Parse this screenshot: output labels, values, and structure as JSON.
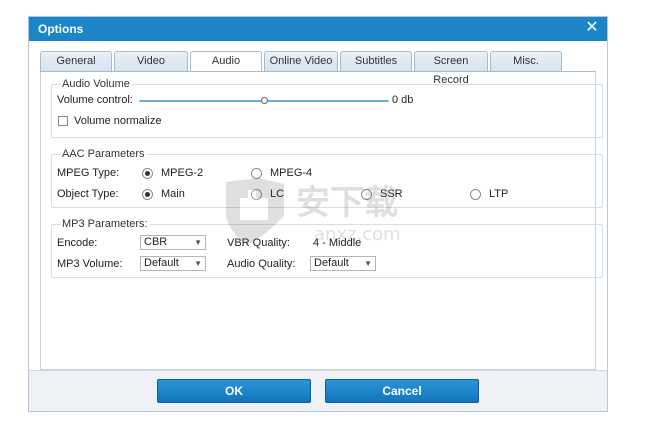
{
  "window": {
    "title": "Options",
    "close_glyph": "✕"
  },
  "tabs": [
    {
      "label": "General"
    },
    {
      "label": "Video"
    },
    {
      "label": "Audio"
    },
    {
      "label": "Online Video"
    },
    {
      "label": "Subtitles"
    },
    {
      "label": "Screen Record"
    },
    {
      "label": "Misc."
    }
  ],
  "active_tab": "Audio",
  "audio_volume": {
    "title": "Audio Volume",
    "volume_label": "Volume control:",
    "volume_value": "0 db",
    "volume_fraction": 0.5,
    "normalize_label": "Volume normalize",
    "normalize_checked": false
  },
  "aac": {
    "title": "AAC Parameters",
    "mpeg_type_label": "MPEG Type:",
    "mpeg_options": [
      "MPEG-2",
      "MPEG-4"
    ],
    "mpeg_selected": "MPEG-2",
    "object_type_label": "Object Type:",
    "object_options": [
      "Main",
      "LC",
      "SSR",
      "LTP"
    ],
    "object_selected": "Main"
  },
  "mp3": {
    "title": "MP3 Parameters:",
    "encode_label": "Encode:",
    "encode_value": "CBR",
    "vbr_quality_label": "VBR Quality:",
    "vbr_quality_value": "4 - Middle",
    "mp3_volume_label": "MP3 Volume:",
    "mp3_volume_value": "Default",
    "audio_quality_label": "Audio Quality:",
    "audio_quality_value": "Default"
  },
  "buttons": {
    "ok": "OK",
    "cancel": "Cancel"
  },
  "watermark": {
    "text": "安下载",
    "subtext": "anxz.com"
  },
  "colors": {
    "titlebar": "#1a86c8",
    "button": "#1a80c4",
    "slider": "#6aaee0"
  }
}
